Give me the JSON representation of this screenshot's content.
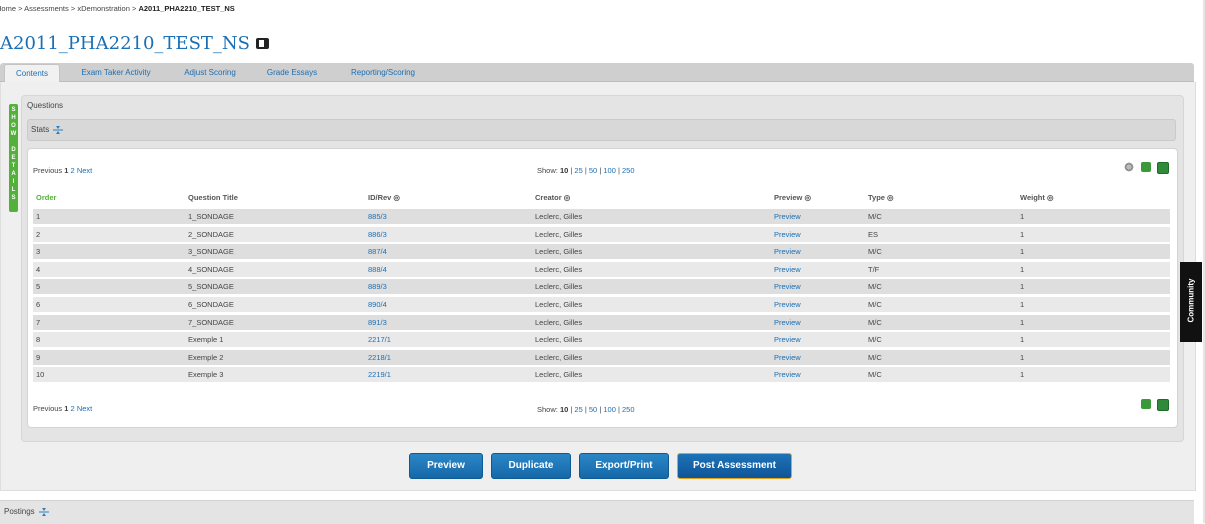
{
  "breadcrumb": {
    "home": "Home",
    "sep": ">",
    "assessments": "Assessments",
    "demo": "xDemonstration",
    "current": "A2011_PHA2210_TEST_NS"
  },
  "page_title": "A2011_PHA2210_TEST_NS",
  "tabs": [
    {
      "label": "Contents",
      "active": true
    },
    {
      "label": "Exam Taker Activity"
    },
    {
      "label": "Adjust Scoring"
    },
    {
      "label": "Grade Essays"
    },
    {
      "label": "Reporting/Scoring"
    }
  ],
  "show_details": "SHOW DETAILS",
  "questions_label": "Questions",
  "stats_label": "Stats",
  "pager": {
    "previous": "Previous",
    "page1": "1",
    "page2": "2",
    "next": "Next"
  },
  "show": {
    "label": "Show:",
    "current": "10",
    "options": [
      "25",
      "50",
      "100",
      "250"
    ]
  },
  "columns": {
    "order": "Order",
    "title": "Question Title",
    "id": "ID/Rev",
    "creator": "Creator",
    "preview": "Preview",
    "type": "Type",
    "weight": "Weight"
  },
  "rows": [
    {
      "order": "1",
      "title": "1_SONDAGE",
      "id": "885/3",
      "creator": "Leclerc, Gilles",
      "preview": "Preview",
      "type": "M/C",
      "weight": "1"
    },
    {
      "order": "2",
      "title": "2_SONDAGE",
      "id": "886/3",
      "creator": "Leclerc, Gilles",
      "preview": "Preview",
      "type": "ES",
      "weight": "1"
    },
    {
      "order": "3",
      "title": "3_SONDAGE",
      "id": "887/4",
      "creator": "Leclerc, Gilles",
      "preview": "Preview",
      "type": "M/C",
      "weight": "1"
    },
    {
      "order": "4",
      "title": "4_SONDAGE",
      "id": "888/4",
      "creator": "Leclerc, Gilles",
      "preview": "Preview",
      "type": "T/F",
      "weight": "1"
    },
    {
      "order": "5",
      "title": "5_SONDAGE",
      "id": "889/3",
      "creator": "Leclerc, Gilles",
      "preview": "Preview",
      "type": "M/C",
      "weight": "1"
    },
    {
      "order": "6",
      "title": "6_SONDAGE",
      "id": "890/4",
      "creator": "Leclerc, Gilles",
      "preview": "Preview",
      "type": "M/C",
      "weight": "1"
    },
    {
      "order": "7",
      "title": "7_SONDAGE",
      "id": "891/3",
      "creator": "Leclerc, Gilles",
      "preview": "Preview",
      "type": "M/C",
      "weight": "1"
    },
    {
      "order": "8",
      "title": "Exemple 1",
      "id": "2217/1",
      "creator": "Leclerc, Gilles",
      "preview": "Preview",
      "type": "M/C",
      "weight": "1"
    },
    {
      "order": "9",
      "title": "Exemple 2",
      "id": "2218/1",
      "creator": "Leclerc, Gilles",
      "preview": "Preview",
      "type": "M/C",
      "weight": "1"
    },
    {
      "order": "10",
      "title": "Exemple 3",
      "id": "2219/1",
      "creator": "Leclerc, Gilles",
      "preview": "Preview",
      "type": "M/C",
      "weight": "1"
    }
  ],
  "buttons": {
    "preview": "Preview",
    "duplicate": "Duplicate",
    "export": "Export/Print",
    "post": "Post Assessment"
  },
  "postings_label": "Postings",
  "community_label": "Community",
  "colors": {
    "link": "#1a6fb5",
    "accent_green": "#53b03a",
    "button_blue": "#1a74b8",
    "post_border": "#e5a21a"
  }
}
